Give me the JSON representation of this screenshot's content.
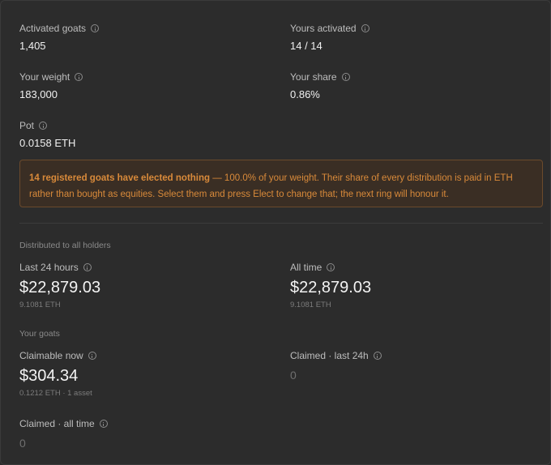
{
  "top_stats": {
    "activated_goats": {
      "label": "Activated goats",
      "value": "1,405"
    },
    "yours_activated": {
      "label": "Yours activated",
      "value": "14 / 14"
    },
    "your_weight": {
      "label": "Your weight",
      "value": "183,000"
    },
    "your_share": {
      "label": "Your share",
      "value": "0.86%"
    },
    "pot": {
      "label": "Pot",
      "value": "0.0158 ETH"
    }
  },
  "notice": {
    "bold": "14 registered goats have elected nothing",
    "text": " — 100.0% of your weight. Their share of every distribution is paid in ETH rather than bought as equities. Select them and press Elect to change that; the next ring will honour it."
  },
  "distributed": {
    "title": "Distributed to all holders",
    "last_24h": {
      "label": "Last 24 hours",
      "value": "$22,879.03",
      "sub": "9.1081 ETH"
    },
    "all_time": {
      "label": "All time",
      "value": "$22,879.03",
      "sub": "9.1081 ETH"
    }
  },
  "your_goats": {
    "title": "Your goats",
    "claimable_now": {
      "label": "Claimable now",
      "value": "$304.34",
      "sub": "0.1212 ETH · 1 asset"
    },
    "claimed_24h": {
      "label": "Claimed · last 24h",
      "value": "0"
    },
    "claimed_all_time": {
      "label": "Claimed · all time",
      "value": "0"
    }
  },
  "colors": {
    "background": "#2c2c2c",
    "notice_bg": "#3a2e24",
    "notice_text": "#d98a3a"
  }
}
